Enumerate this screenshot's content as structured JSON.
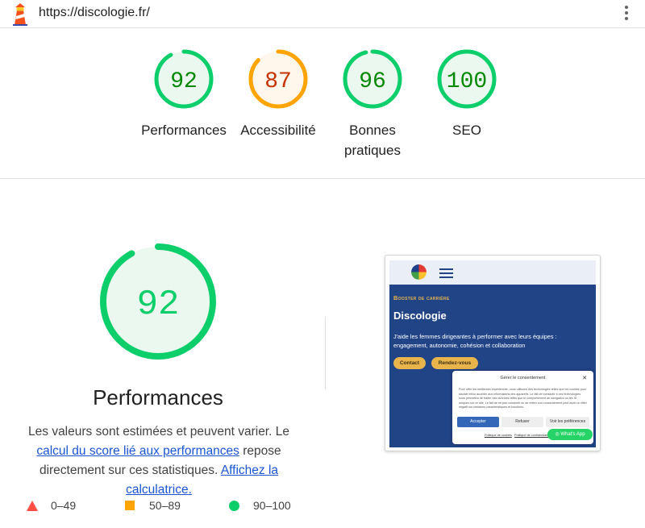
{
  "browser": {
    "url": "https://discologie.fr/",
    "logo_icon": "lighthouse-icon",
    "menu_icon": "kebab-menu-icon"
  },
  "summary_gauges": [
    {
      "score": "92",
      "label_lines": [
        "Performances"
      ],
      "status": "pass"
    },
    {
      "score": "87",
      "label_lines": [
        "Accessibilité"
      ],
      "status": "average"
    },
    {
      "score": "96",
      "label_lines": [
        "Bonnes",
        "pratiques"
      ],
      "status": "pass"
    },
    {
      "score": "100",
      "label_lines": [
        "SEO"
      ],
      "status": "pass"
    }
  ],
  "performance": {
    "score": "92",
    "title": "Performances",
    "description": {
      "text_1": "Les valeurs sont estimées et peuvent varier. Le ",
      "link_1": "calcul du score lié aux performances",
      "text_2": " repose directement sur ces statistiques. ",
      "link_2": "Affichez la calculatrice."
    }
  },
  "legend": [
    {
      "shape": "triangle",
      "range": "0–49"
    },
    {
      "shape": "square",
      "range": "50–89"
    },
    {
      "shape": "circle",
      "range": "90–100"
    }
  ],
  "screenshot": {
    "kicker": "Booster de carrière",
    "heading": "Discologie",
    "paragraph": "J'aide les femmes dirigeantes à performer avec leurs équipes : engagement, autonomie, cohésion et collaboration",
    "buttons": [
      "Contact",
      "Rendez-vous"
    ],
    "consent": {
      "title": "Gérer le consentement",
      "close": "✕",
      "text": "Pour offrir les meilleures expériences, nous utilisons des technologies telles que les cookies pour stocker et/ou accéder aux informations des appareils. Le fait de consentir à ces technologies nous permettra de traiter des données telles que le comportement de navigation ou les ID uniques sur ce site. Le fait de ne pas consentir ou de retirer son consentement peut avoir un effet négatif sur certaines caractéristiques et fonctions.",
      "accept": "Accepter",
      "refuse": "Refuser",
      "preferences": "Voir les préférences",
      "link_1": "Politique de cookies",
      "link_2": "Politique de confidentialité"
    },
    "whatsapp": "What's App"
  },
  "colors": {
    "pass": "#0cce6b",
    "pass_text": "#008800",
    "pass_bg": "#ebf8ef",
    "average": "#ffa400",
    "average_text": "#c33300",
    "average_bg": "#fff6ec",
    "fail": "#ff4e42",
    "brand_blue": "#214487",
    "brand_gold": "#e9b44c"
  }
}
